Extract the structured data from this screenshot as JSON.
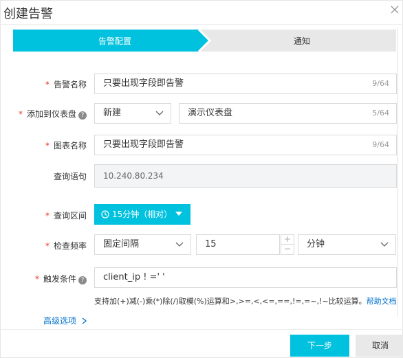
{
  "dialog": {
    "title": "创建告警",
    "close_icon": "close-icon"
  },
  "steps": [
    {
      "label": "告警配置",
      "active": true
    },
    {
      "label": "通知",
      "active": false
    }
  ],
  "form": {
    "alert_name": {
      "label": "告警名称",
      "required": true,
      "value": "只要出现字段即告警",
      "counter": "9/64"
    },
    "dashboard": {
      "label": "添加到仪表盘",
      "required": true,
      "select_value": "新建",
      "value": "演示仪表盘",
      "counter": "5/64"
    },
    "chart_name": {
      "label": "图表名称",
      "required": true,
      "value": "只要出现字段即告警",
      "counter": "9/64"
    },
    "query": {
      "label": "查询语句",
      "required": false,
      "value": "10.240.80.234"
    },
    "query_range": {
      "label": "查询区间",
      "required": true,
      "value": "15分钟（相对）"
    },
    "check_freq": {
      "label": "检查频率",
      "required": true,
      "mode": "固定间隔",
      "number": "15",
      "unit": "分钟",
      "plus": "+",
      "minus": "−"
    },
    "trigger": {
      "label": "触发条件",
      "required": true,
      "value": "client_ip  ! =' '",
      "hint": "支持加(+)减(-)乘(*)除(/)取模(%)运算和>,>=,<,<=,==,!=,=~,!~比较运算。",
      "help_link": "帮助文档"
    },
    "advanced": "高级选项"
  },
  "footer": {
    "next": "下一步",
    "cancel": "取消"
  },
  "colors": {
    "accent": "#00c1de",
    "required": "#ee3322",
    "link": "#0070cc"
  }
}
